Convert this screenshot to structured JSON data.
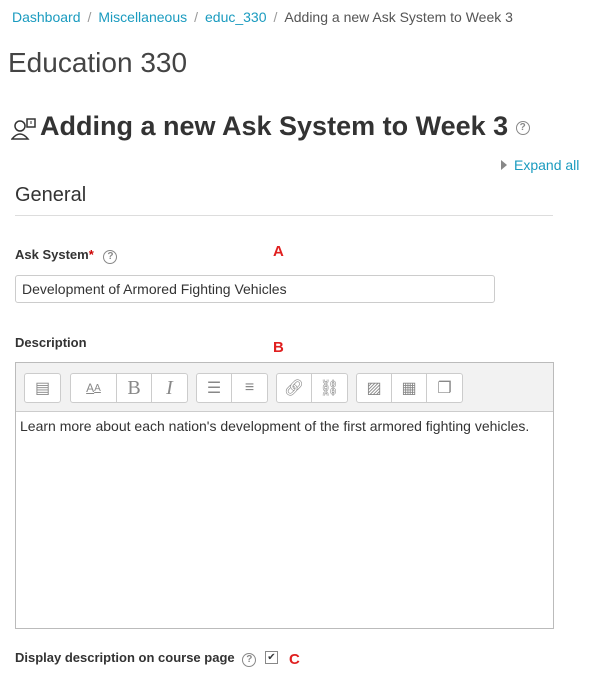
{
  "breadcrumb": [
    "Dashboard",
    "Miscellaneous",
    "educ_330",
    "Adding a new Ask System to Week 3"
  ],
  "course_title": "Education 330",
  "page_title": "Adding a new Ask System to Week 3",
  "expand_all": "Expand all",
  "section": "General",
  "name_field": {
    "label": "Ask System",
    "required": "*",
    "value": "Development of Armored Fighting Vehicles"
  },
  "description": {
    "label": "Description",
    "content": "Learn more about each nation's development of the first armored fighting vehicles."
  },
  "display_description": {
    "label": "Display description on course page",
    "checked": true
  },
  "annotations": [
    "A",
    "B",
    "C"
  ]
}
